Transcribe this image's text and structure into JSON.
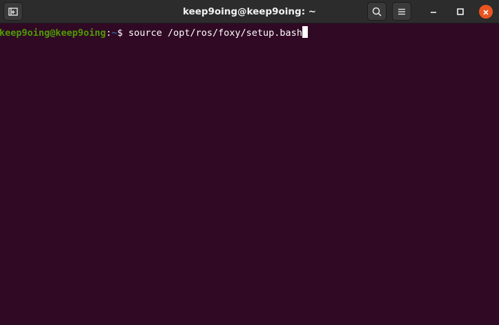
{
  "window": {
    "title": "keep9oing@keep9oing: ~"
  },
  "header": {
    "icons": {
      "new_tab": "new-tab-icon",
      "search": "search-icon",
      "menu": "hamburger-menu-icon",
      "minimize": "minimize-icon",
      "maximize": "maximize-icon",
      "close": "close-icon"
    }
  },
  "terminal": {
    "prompt": {
      "user_host": "keep9oing@keep9oing",
      "separator": ":",
      "path": "~",
      "symbol": "$ "
    },
    "command": "source /opt/ros/foxy/setup.bash"
  },
  "colors": {
    "background": "#300a24",
    "titlebar": "#2c2c2c",
    "prompt_user": "#4e9a06",
    "prompt_path": "#3465a4",
    "close_button": "#e95420"
  }
}
